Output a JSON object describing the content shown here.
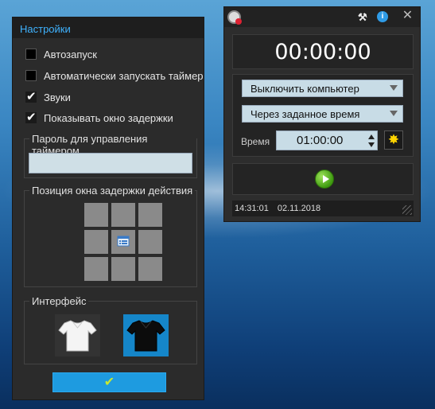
{
  "settings": {
    "title": "Настройки",
    "checkboxes": [
      {
        "label": "Автозапуск",
        "checked": false
      },
      {
        "label": "Автоматически запускать таймер",
        "checked": false
      },
      {
        "label": "Звуки",
        "checked": true
      },
      {
        "label": "Показывать окно задержки",
        "checked": true
      }
    ],
    "password_group": {
      "legend": "Пароль для управления таймером",
      "value": ""
    },
    "position_group": {
      "legend": "Позиция окна задержки действия"
    },
    "interface_group": {
      "legend": "Интерфейс",
      "themes": [
        "white-shirt",
        "black-shirt"
      ],
      "selected": "black-shirt"
    },
    "ok_icon": "checkmark-icon",
    "ok_symbol": "✔"
  },
  "timer": {
    "clock": "00:00:00",
    "action": "Выключить компьютер",
    "mode": "Через заданное время",
    "time_label": "Время",
    "time_value": "01:00:00",
    "status_time": "14:31:01",
    "status_date": "02.11.2018",
    "close_symbol": "✕",
    "info_symbol": "i",
    "star_symbol": "✸",
    "tools_symbol": "⚒"
  },
  "colors": {
    "accent": "#3fb3ff",
    "ok_button": "#1e9be0",
    "play": "#3e9a10",
    "star": "#ffd400"
  }
}
